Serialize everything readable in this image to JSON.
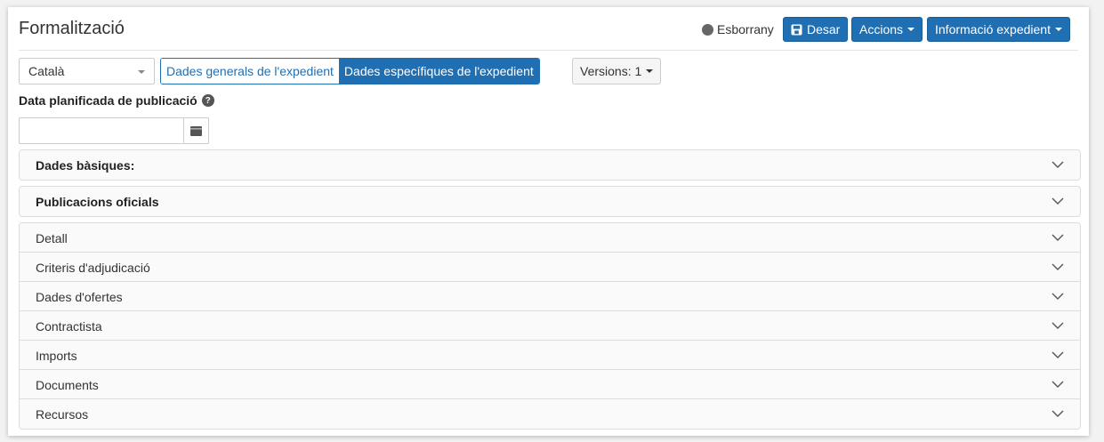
{
  "header": {
    "title": "Formalització",
    "status": "Esborrany",
    "save_label": "Desar",
    "actions_label": "Accions",
    "info_label": "Informació expedient"
  },
  "toolbar": {
    "language": "Català",
    "tab_general": "Dades generals de l'expedient",
    "tab_specific": "Dades específiques de l'expedient",
    "versions_label": "Versions: 1"
  },
  "date_field": {
    "label": "Data planificada de publicació",
    "value": ""
  },
  "panels": {
    "basic": "Dades bàsiques:",
    "publications": "Publicacions oficials",
    "sections": [
      "Detall",
      "Criteris d'adjudicació",
      "Dades d'ofertes",
      "Contractista",
      "Imports",
      "Documents",
      "Recursos"
    ]
  },
  "colors": {
    "accent": "#1f6fb2",
    "status_dot": "#666666"
  }
}
